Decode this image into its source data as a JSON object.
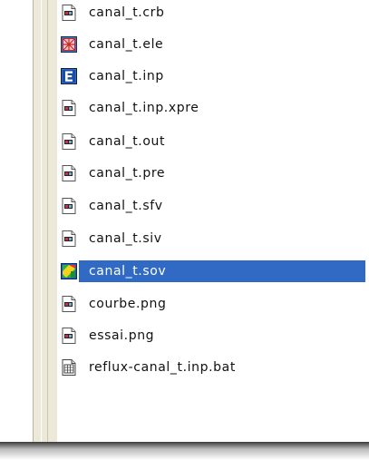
{
  "files": [
    {
      "name": "canal_t.crb",
      "icon": "generic-file-icon"
    },
    {
      "name": "canal_t.ele",
      "icon": "mesh-file-icon"
    },
    {
      "name": "canal_t.inp",
      "icon": "e-app-icon"
    },
    {
      "name": "canal_t.inp.xpre",
      "icon": "generic-file-icon"
    },
    {
      "name": "canal_t.out",
      "icon": "generic-file-icon"
    },
    {
      "name": "canal_t.pre",
      "icon": "generic-file-icon"
    },
    {
      "name": "canal_t.sfv",
      "icon": "generic-file-icon"
    },
    {
      "name": "canal_t.siv",
      "icon": "generic-file-icon"
    },
    {
      "name": "canal_t.sov",
      "icon": "colormap-file-icon",
      "selected": true
    },
    {
      "name": "courbe.png",
      "icon": "generic-file-icon"
    },
    {
      "name": "essai.png",
      "icon": "generic-file-icon"
    },
    {
      "name": "reflux-canal_t.inp.bat",
      "icon": "batch-file-icon"
    }
  ],
  "colors": {
    "selection": "#316ac5",
    "selected_text": "#ffffff",
    "text": "#111111"
  }
}
